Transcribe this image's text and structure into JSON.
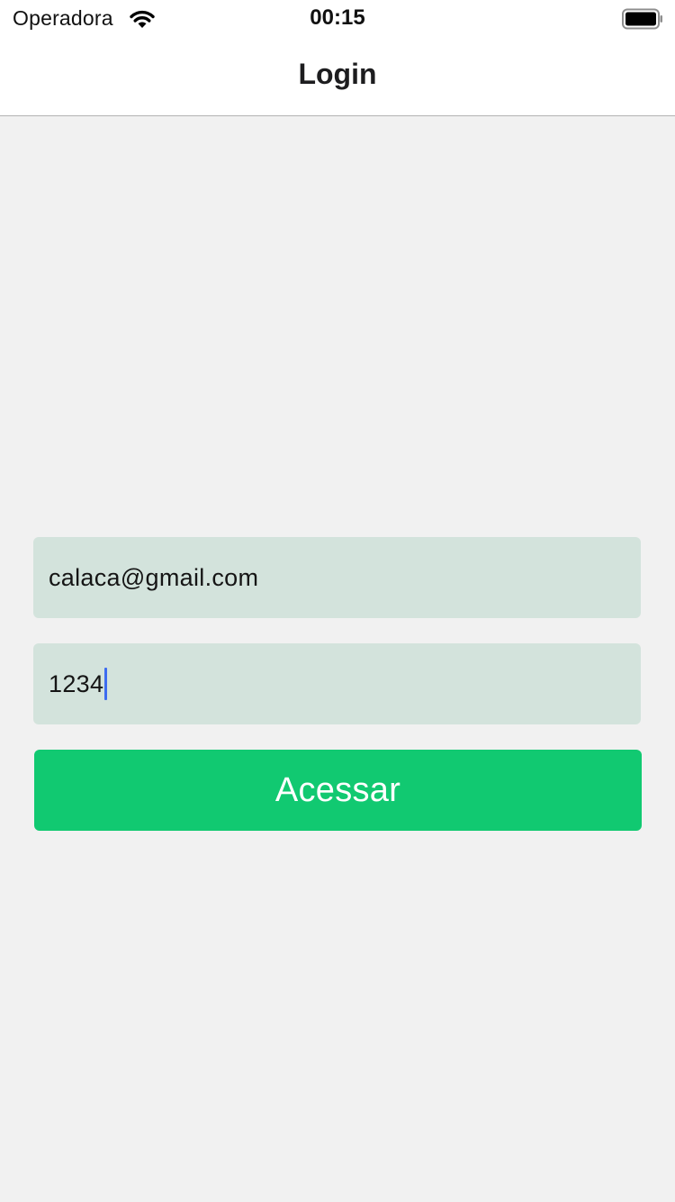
{
  "status_bar": {
    "carrier": "Operadora",
    "time": "00:15",
    "wifi_icon": "wifi-icon",
    "battery_icon": "battery-full-icon"
  },
  "nav": {
    "title": "Login"
  },
  "form": {
    "email_value": "calaca@gmail.com",
    "password_value": "1234",
    "submit_label": "Acessar"
  },
  "colors": {
    "background": "#f1f1f1",
    "field_background": "#d3e3dc",
    "button": "#11c971",
    "caret": "#3d6cf0"
  }
}
